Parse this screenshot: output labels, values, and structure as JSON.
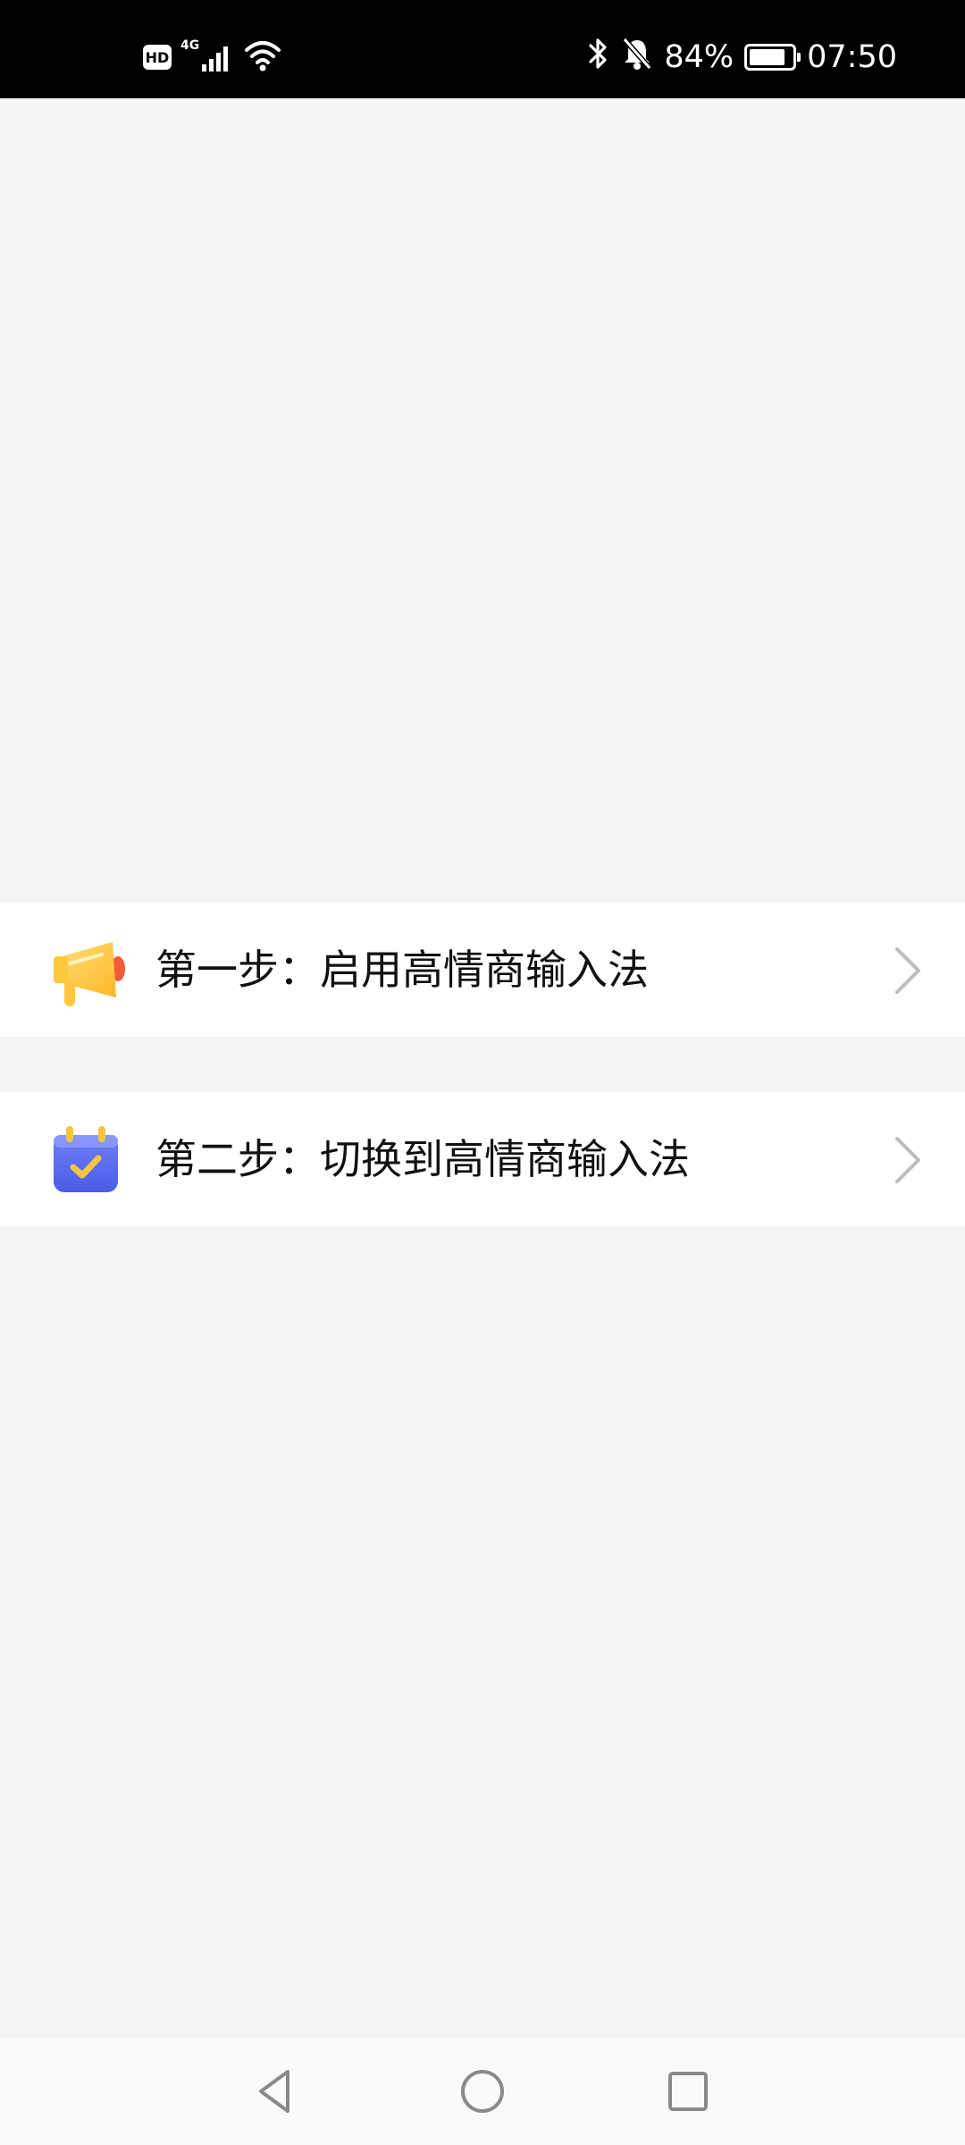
{
  "status_bar": {
    "network_badge": "HD",
    "network_type": "4G",
    "icons": [
      "hd-icon",
      "cellular-signal-icon",
      "wifi-icon",
      "bluetooth-icon",
      "mute-bell-icon",
      "battery-icon"
    ],
    "battery_percent_text": "84%",
    "battery_level": 0.84,
    "time": "07:50"
  },
  "steps": [
    {
      "label": "第一步：启用高情商输入法",
      "icon": "megaphone-icon",
      "colors": {
        "primary": "#FFC83D",
        "accent": "#F25B3A"
      }
    },
    {
      "label": "第二步：切换到高情商输入法",
      "icon": "calendar-check-icon",
      "colors": {
        "primary": "#5B6FF0",
        "accent": "#F5C542"
      }
    }
  ],
  "nav_bar": {
    "buttons": [
      "back-icon",
      "home-icon",
      "recents-icon"
    ]
  },
  "colors": {
    "background": "#F4F4F4",
    "row_background": "#FFFFFF",
    "chevron": "#BDBDBD",
    "status_bar": "#000000"
  }
}
